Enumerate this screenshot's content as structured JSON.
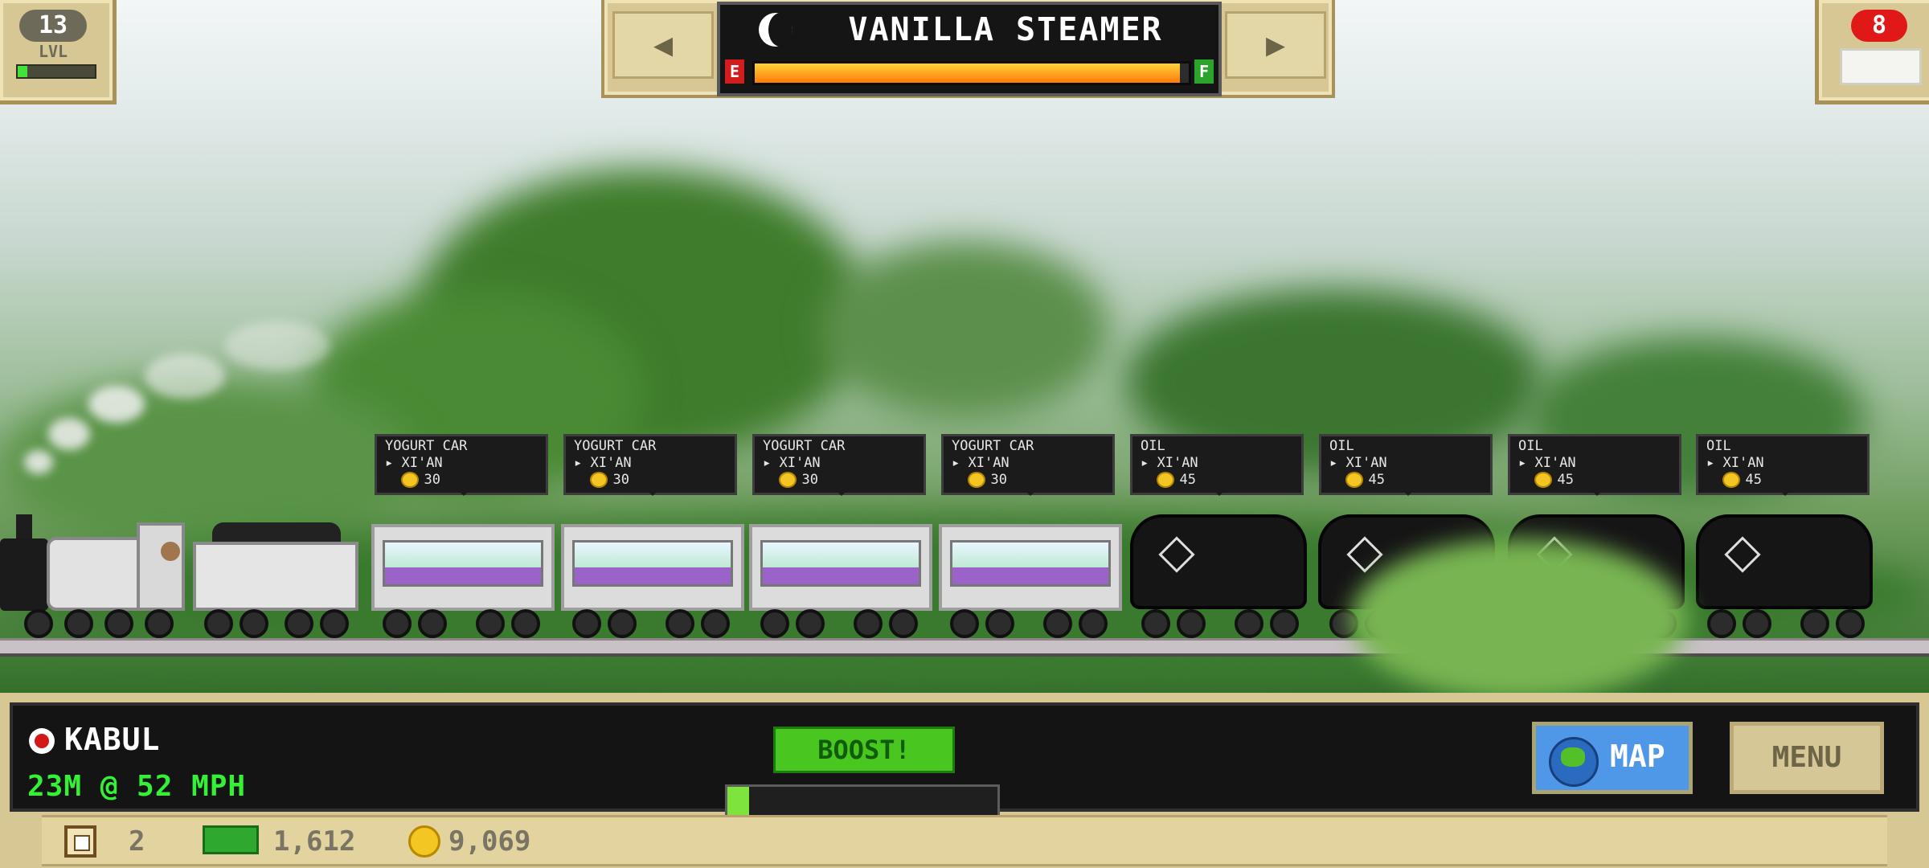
{
  "level": {
    "number": "13",
    "label": "LVL",
    "progress_fraction": 0.12
  },
  "train": {
    "name": "VANILLA STEAMER",
    "fuel_empty_label": "E",
    "fuel_full_label": "F",
    "fuel_fraction": 0.98,
    "prev_arrow": "◀",
    "next_arrow": "▶"
  },
  "train_count": {
    "value": "8"
  },
  "cargo": [
    {
      "type": "YOGURT CAR",
      "destination": "XI'AN",
      "reward": "30"
    },
    {
      "type": "YOGURT CAR",
      "destination": "XI'AN",
      "reward": "30"
    },
    {
      "type": "YOGURT CAR",
      "destination": "XI'AN",
      "reward": "30"
    },
    {
      "type": "YOGURT CAR",
      "destination": "XI'AN",
      "reward": "30"
    },
    {
      "type": "OIL",
      "destination": "XI'AN",
      "reward": "45"
    },
    {
      "type": "OIL",
      "destination": "XI'AN",
      "reward": "45"
    },
    {
      "type": "OIL",
      "destination": "XI'AN",
      "reward": "45"
    },
    {
      "type": "OIL",
      "destination": "XI'AN",
      "reward": "45"
    }
  ],
  "hud": {
    "station": "KABUL",
    "speed_text": "23M @ 52 MPH",
    "boost_label": "BOOST!",
    "boost_fraction": 0.08,
    "map_label": "MAP",
    "menu_label": "MENU"
  },
  "stats": {
    "crates": "2",
    "cash": "1,612",
    "coins": "9,069"
  },
  "colors": {
    "hud_panel": "#d7c795",
    "speed_green": "#35f135",
    "boost_green": "#4ac621",
    "map_blue": "#4f97e7",
    "badge_red": "#e01818"
  }
}
